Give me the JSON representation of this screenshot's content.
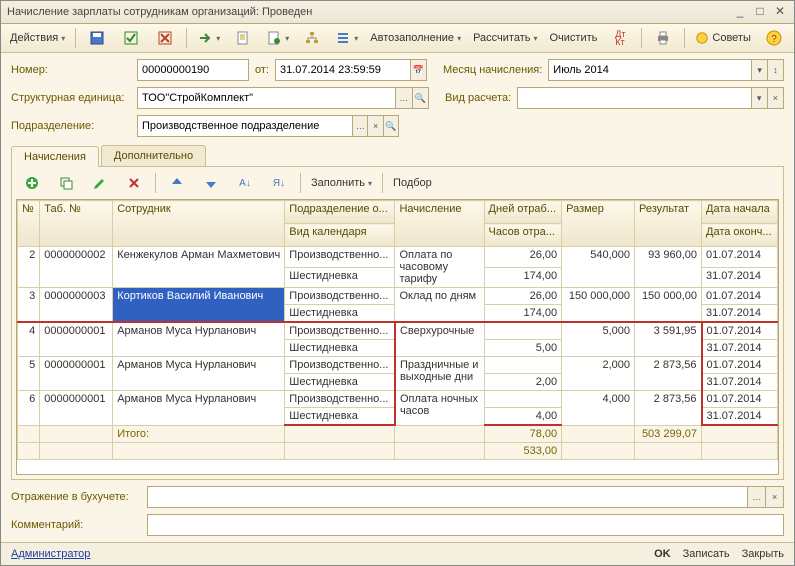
{
  "title": "Начисление зарплаты сотрудникам организаций: Проведен",
  "toolbar": {
    "actions": "Действия",
    "autofill": "Автозаполнение",
    "calc": "Рассчитать",
    "clear": "Очистить",
    "tips": "Советы"
  },
  "form": {
    "number_lbl": "Номер:",
    "number": "00000000190",
    "from_lbl": "от:",
    "from": "31.07.2014 23:59:59",
    "month_lbl": "Месяц начисления:",
    "month": "Июль 2014",
    "unit_lbl": "Структурная единица:",
    "unit": "ТОО\"СтройКомплект\"",
    "calc_kind_lbl": "Вид расчета:",
    "calc_kind": "",
    "dept_lbl": "Подразделение:",
    "dept": "Производственное подразделение"
  },
  "tabs": {
    "t1": "Начисления",
    "t2": "Дополнительно"
  },
  "mini": {
    "fill": "Заполнить",
    "pick": "Подбор"
  },
  "cols": {
    "n": "№",
    "tab": "Таб. №",
    "emp": "Сотрудник",
    "dept": "Подразделение о...",
    "cal": "Вид календаря",
    "accr": "Начисление",
    "days": "Дней отраб...",
    "hours": "Часов отра...",
    "size": "Размер",
    "res": "Результат",
    "dstart": "Дата начала",
    "dend": "Дата оконч..."
  },
  "rows": [
    {
      "n": "2",
      "tab": "0000000002",
      "emp": "Кенжекулов Арман Махметович",
      "dept": "Производственно...",
      "cal": "Шестидневка",
      "accr": "Оплата по часовому тарифу",
      "days": "26,00",
      "hours": "174,00",
      "size": "540,000",
      "res": "93 960,00",
      "d1": "01.07.2014",
      "d2": "31.07.2014",
      "sel": false
    },
    {
      "n": "3",
      "tab": "0000000003",
      "emp": "Кортиков Василий Иванович",
      "dept": "Производственно...",
      "cal": "Шестидневка",
      "accr": "Оклад по дням",
      "days": "26,00",
      "hours": "174,00",
      "size": "150 000,000",
      "res": "150 000,00",
      "d1": "01.07.2014",
      "d2": "31.07.2014",
      "sel": true
    },
    {
      "n": "4",
      "tab": "0000000001",
      "emp": "Арманов Муса Нурланович",
      "dept": "Производственно...",
      "cal": "Шестидневка",
      "accr": "Сверхурочные",
      "days": "",
      "hours": "5,00",
      "size": "5,000",
      "res": "3 591,95",
      "d1": "01.07.2014",
      "d2": "31.07.2014"
    },
    {
      "n": "5",
      "tab": "0000000001",
      "emp": "Арманов Муса Нурланович",
      "dept": "Производственно...",
      "cal": "Шестидневка",
      "accr": "Праздничные и выходные дни",
      "days": "",
      "hours": "2,00",
      "size": "2,000",
      "res": "2 873,56",
      "d1": "01.07.2014",
      "d2": "31.07.2014"
    },
    {
      "n": "6",
      "tab": "0000000001",
      "emp": "Арманов Муса Нурланович",
      "dept": "Производственно...",
      "cal": "Шестидневка",
      "accr": "Оплата ночных часов",
      "days": "",
      "hours": "4,00",
      "size": "4,000",
      "res": "2 873,56",
      "d1": "01.07.2014",
      "d2": "31.07.2014"
    }
  ],
  "totals": {
    "label": "Итого:",
    "days": "78,00",
    "hours": "533,00",
    "res": "503 299,07"
  },
  "bottom": {
    "acc_lbl": "Отражение в бухучете:",
    "acc": "",
    "comment_lbl": "Комментарий:",
    "comment": ""
  },
  "status": {
    "user": "Администратор",
    "ok": "OK",
    "save": "Записать",
    "close": "Закрыть"
  }
}
